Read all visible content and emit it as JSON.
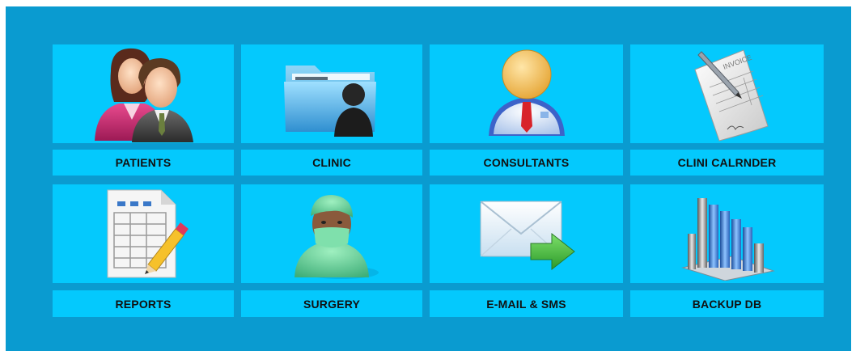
{
  "modules": [
    {
      "label": "PATIENTS",
      "icon": "patients-icon"
    },
    {
      "label": "CLINIC",
      "icon": "folder-user-icon"
    },
    {
      "label": "CONSULTANTS",
      "icon": "consultant-icon"
    },
    {
      "label": "CLINI CALRNDER",
      "icon": "invoice-icon"
    },
    {
      "label": "REPORTS",
      "icon": "report-table-icon"
    },
    {
      "label": "SURGERY",
      "icon": "surgeon-icon"
    },
    {
      "label": "E-MAIL & SMS",
      "icon": "email-send-icon"
    },
    {
      "label": "BACKUP DB",
      "icon": "bar-chart-icon"
    }
  ],
  "invoice_text": "INVOICE",
  "colors": {
    "background": "#0a9bd0",
    "tile": "#04c9fd"
  }
}
